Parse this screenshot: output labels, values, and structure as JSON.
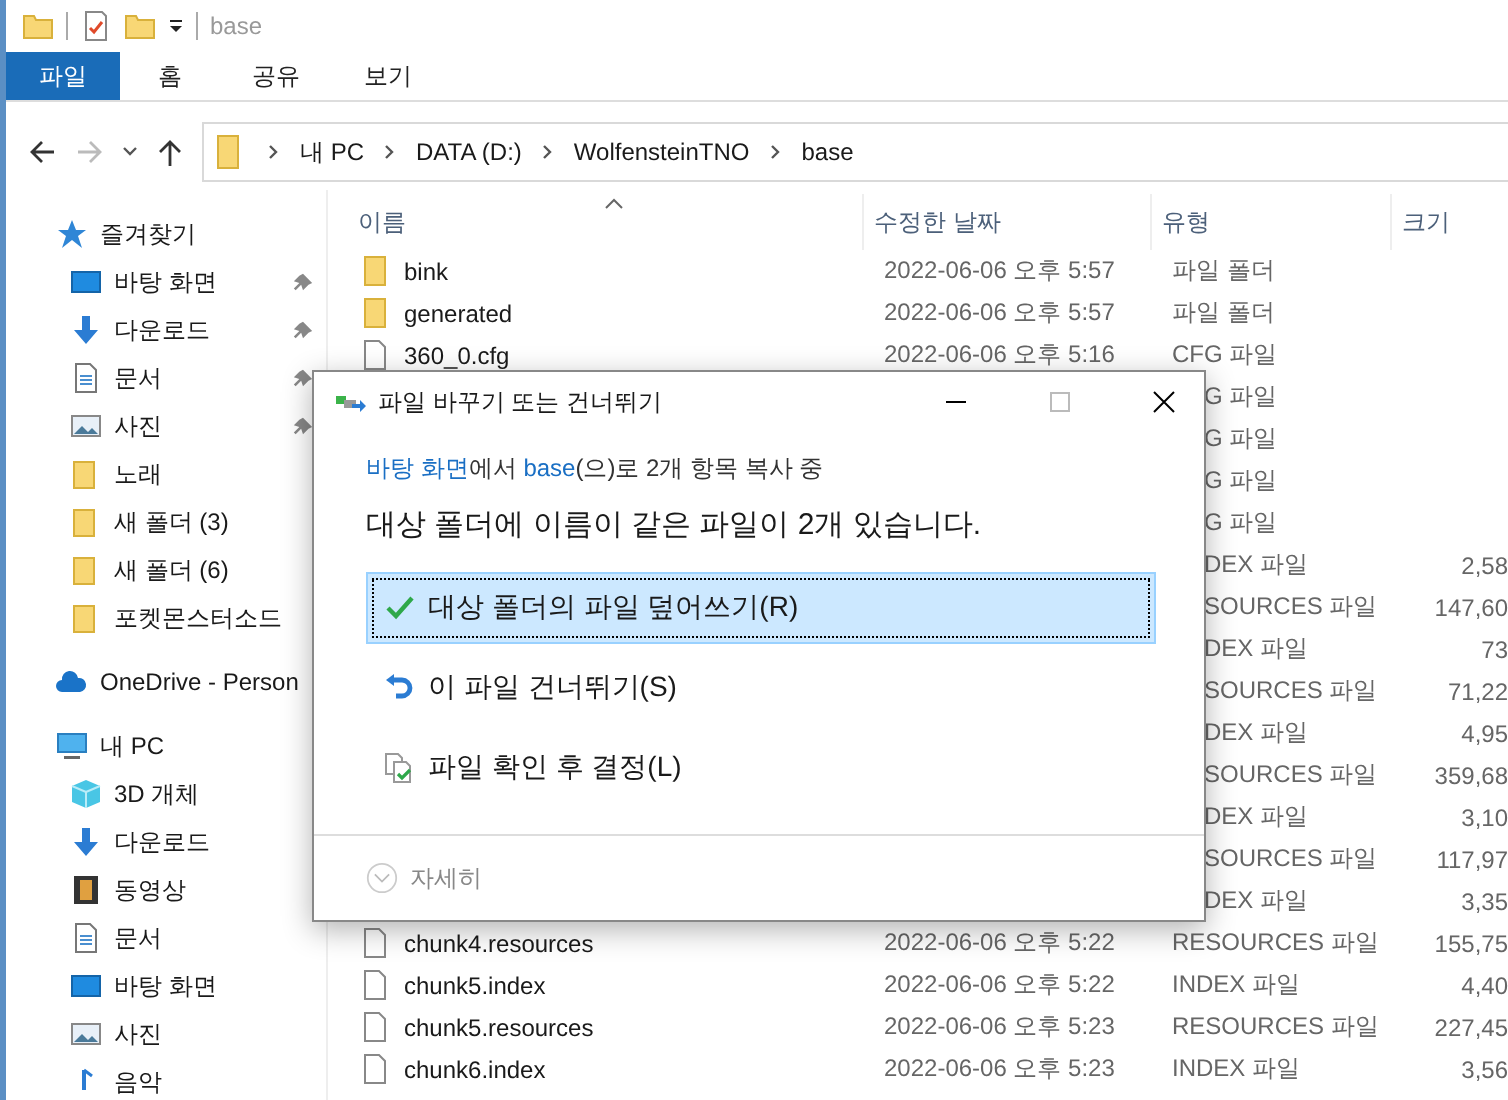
{
  "window": {
    "title": "base"
  },
  "ribbon_tabs": [
    {
      "label": "파일",
      "selected": true
    },
    {
      "label": "홈",
      "selected": false
    },
    {
      "label": "공유",
      "selected": false
    },
    {
      "label": "보기",
      "selected": false
    }
  ],
  "address": {
    "crumbs": [
      "내 PC",
      "DATA (D:)",
      "WolfensteinTNO",
      "base"
    ]
  },
  "sidebar": {
    "items": [
      {
        "label": "즐겨찾기",
        "kind": "star",
        "children": [
          {
            "label": "바탕 화면",
            "kind": "desktop",
            "pinned": true
          },
          {
            "label": "다운로드",
            "kind": "download",
            "pinned": true
          },
          {
            "label": "문서",
            "kind": "doc",
            "pinned": true
          },
          {
            "label": "사진",
            "kind": "pictures",
            "pinned": true
          },
          {
            "label": "노래",
            "kind": "folder",
            "pinned": false
          },
          {
            "label": "새 폴더 (3)",
            "kind": "folder",
            "pinned": false
          },
          {
            "label": "새 폴더 (6)",
            "kind": "folder",
            "pinned": false
          },
          {
            "label": "포켓몬스터소드",
            "kind": "folder",
            "pinned": false
          }
        ]
      },
      {
        "label": "OneDrive - Person",
        "kind": "cloud"
      },
      {
        "label": "내 PC",
        "kind": "pc",
        "children": [
          {
            "label": "3D 개체",
            "kind": "cube",
            "pinned": false
          },
          {
            "label": "다운로드",
            "kind": "download",
            "pinned": false
          },
          {
            "label": "동영상",
            "kind": "video",
            "pinned": false
          },
          {
            "label": "문서",
            "kind": "doc",
            "pinned": false
          },
          {
            "label": "바탕 화면",
            "kind": "desktop",
            "pinned": false
          },
          {
            "label": "사진",
            "kind": "pictures",
            "pinned": false
          },
          {
            "label": "음악",
            "kind": "music",
            "pinned": false
          }
        ]
      }
    ]
  },
  "table": {
    "columns": [
      "이름",
      "수정한 날짜",
      "유형",
      "크기"
    ],
    "rows": [
      {
        "name": "bink",
        "kind": "folder",
        "date": "2022-06-06 오후 5:57",
        "type": "파일 폴더"
      },
      {
        "name": "generated",
        "kind": "folder",
        "date": "2022-06-06 오후 5:57",
        "type": "파일 폴더"
      },
      {
        "name": "360_0.cfg",
        "kind": "file",
        "date": "2022-06-06 오후 5:16",
        "type": "CFG 파일"
      },
      {
        "type": "G 파일"
      },
      {
        "type": "G 파일"
      },
      {
        "type": "G 파일"
      },
      {
        "type": "G 파일"
      },
      {
        "type": "DEX 파일",
        "size": "2,58"
      },
      {
        "type": "SOURCES 파일",
        "size": "147,60"
      },
      {
        "type": "DEX 파일",
        "size": "73"
      },
      {
        "type": "SOURCES 파일",
        "size": "71,22"
      },
      {
        "type": "DEX 파일",
        "size": "4,95"
      },
      {
        "type": "SOURCES 파일",
        "size": "359,68"
      },
      {
        "type": "DEX 파일",
        "size": "3,10"
      },
      {
        "type": "SOURCES 파일",
        "size": "117,97"
      },
      {
        "type": "DEX 파일",
        "size": "3,35"
      },
      {
        "name": "chunk4.resources",
        "kind": "file",
        "date": "2022-06-06 오후 5:22",
        "type": "RESOURCES 파일",
        "size": "155,75"
      },
      {
        "name": "chunk5.index",
        "kind": "file",
        "date": "2022-06-06 오후 5:22",
        "type": "INDEX 파일",
        "size": "4,40"
      },
      {
        "name": "chunk5.resources",
        "kind": "file",
        "date": "2022-06-06 오후 5:23",
        "type": "RESOURCES 파일",
        "size": "227,45"
      },
      {
        "name": "chunk6.index",
        "kind": "file",
        "date": "2022-06-06 오후 5:23",
        "type": "INDEX 파일",
        "size": "3,56"
      }
    ]
  },
  "dialog": {
    "title": "파일 바꾸기 또는 건너뛰기",
    "subtitle": [
      {
        "text": "바탕 화면",
        "link": true
      },
      {
        "text": "에서 ",
        "link": false
      },
      {
        "text": "base",
        "link": true
      },
      {
        "text": "(으)로 2개 항목 복사 중",
        "link": false
      }
    ],
    "heading": "대상 폴더에 이름이 같은 파일이 2개 있습니다.",
    "options": [
      {
        "label": "대상 폴더의 파일 덮어쓰기(R)",
        "kind": "replace",
        "selected": true
      },
      {
        "label": "이 파일 건너뛰기(S)",
        "kind": "skip",
        "selected": false
      },
      {
        "label": "파일 확인 후 결정(L)",
        "kind": "compare",
        "selected": false
      }
    ],
    "details": "자세히"
  }
}
